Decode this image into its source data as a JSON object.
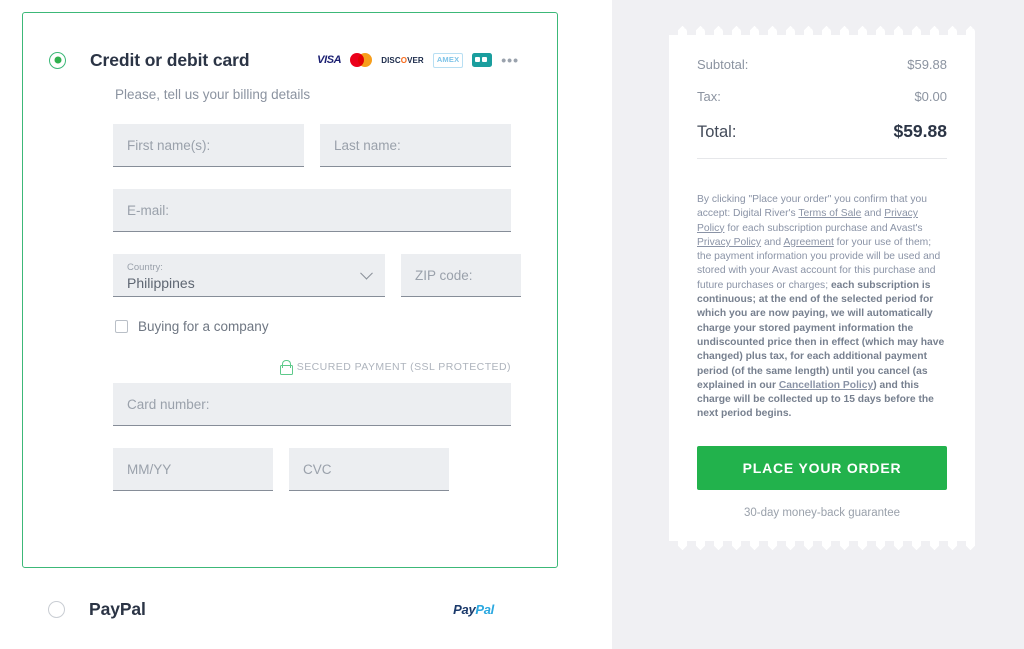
{
  "payment_methods": {
    "credit_card": {
      "title": "Credit or debit card",
      "selected": true,
      "billing_note": "Please, tell us your billing details",
      "brands": [
        {
          "name": "visa-logo",
          "label": "VISA"
        },
        {
          "name": "mastercard-logo",
          "label": ""
        },
        {
          "name": "discover-logo",
          "label": "DISC",
          "label_accent": "O",
          "label_tail": "VER"
        },
        {
          "name": "amex-logo",
          "label": "AMEX"
        },
        {
          "name": "generic-card-logo",
          "label": ""
        },
        {
          "name": "more-brands-icon",
          "label": "•••"
        }
      ],
      "fields": {
        "first_name": {
          "placeholder": "First name(s):",
          "value": ""
        },
        "last_name": {
          "placeholder": "Last name:",
          "value": ""
        },
        "email": {
          "placeholder": "E-mail:",
          "value": ""
        },
        "country": {
          "label": "Country:",
          "value": "Philippines"
        },
        "zip": {
          "placeholder": "ZIP code:",
          "value": ""
        },
        "card_number": {
          "placeholder": "Card number:",
          "value": ""
        },
        "expiry": {
          "placeholder": "MM/YY",
          "value": ""
        },
        "cvc": {
          "placeholder": "CVC",
          "value": ""
        }
      },
      "company_checkbox": {
        "label": "Buying for a company",
        "checked": false
      },
      "secure_note": "SECURED PAYMENT (SSL PROTECTED)"
    },
    "paypal": {
      "title": "PayPal",
      "selected": false,
      "logo_first": "Pay",
      "logo_second": "Pal"
    }
  },
  "summary": {
    "rows": [
      {
        "label": "Subtotal:",
        "value": "$59.88"
      },
      {
        "label": "Tax:",
        "value": "$0.00"
      }
    ],
    "total": {
      "label": "Total:",
      "value": "$59.88"
    },
    "legal": {
      "p1": "By clicking \"Place your order\" you confirm that you accept: Digital River's ",
      "link1": "Terms of Sale",
      "p2": " and ",
      "link2": "Privacy Policy",
      "p3": " for each subscription purchase and Avast's ",
      "link3": "Privacy Policy",
      "p4": " and ",
      "link4": "Agreement",
      "p5": " for your use of them; the payment information you provide will be used and stored with your Avast account for this purchase and future purchases or charges; ",
      "bold1": "each subscription is continuous; at the end of the selected period for which you are now paying, we will automatically charge your stored payment information the undiscounted price then in effect (which may have changed) plus tax, for each additional payment period (of the same length) until you cancel (as explained in our ",
      "link5": "Cancellation Policy",
      "bold2": ") and this charge will be collected up to 15 days before the next period begins."
    },
    "place_order_button": "PLACE YOUR ORDER",
    "guarantee": "30-day money-back guarantee"
  },
  "colors": {
    "accent_green": "#22b24c",
    "panel_border_green": "#3cb878",
    "field_bg": "#eceef1",
    "page_bg_right": "#f0f0f3"
  }
}
